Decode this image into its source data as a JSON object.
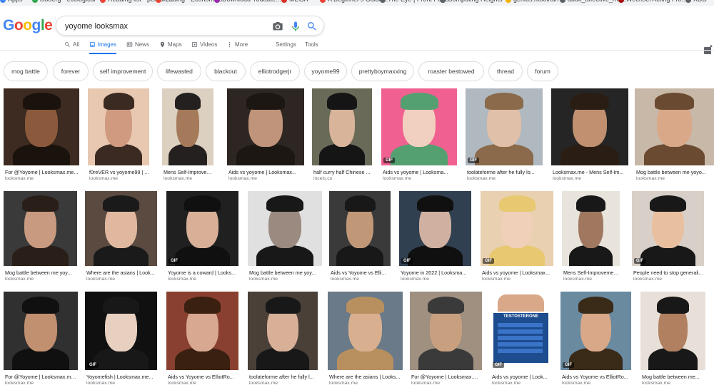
{
  "bookmarks": [
    {
      "label": "Apps",
      "color": "#4285f4"
    },
    {
      "label": "isoberg - ecological",
      "color": "#34a853"
    },
    {
      "label": "Reading list - person...",
      "color": "#ea4335"
    },
    {
      "label": "reading - Economics",
      "color": "#ea4335"
    },
    {
      "label": "Download Youtube...",
      "color": "#9c27b0"
    },
    {
      "label": "MEGA",
      "color": "#d93025"
    },
    {
      "label": "A Beginner's Guide...",
      "color": "#ea4335"
    },
    {
      "label": "The Eye | Front Page",
      "color": "#5f6368"
    },
    {
      "label": "Computing Heights",
      "color": "#5f6368"
    },
    {
      "label": "genius.ntoolrain",
      "color": "#f4b400"
    },
    {
      "label": "adult_affective_me...",
      "color": "#5f6368"
    },
    {
      "label": "Wechsel Acting Fro...",
      "color": "#a50e0e"
    },
    {
      "label": "XDD",
      "color": "#5f6368"
    }
  ],
  "search": {
    "query": "yoyome looksmax",
    "camera_icon": "camera-icon",
    "mic_icon": "mic-icon",
    "search_icon": "search-icon"
  },
  "logo": {
    "letters": [
      "G",
      "o",
      "o",
      "g",
      "l",
      "e"
    ],
    "colors": [
      "#4285f4",
      "#ea4335",
      "#fbbc05",
      "#4285f4",
      "#34a853",
      "#ea4335"
    ]
  },
  "tabs": [
    {
      "label": "All",
      "icon": "search-icon"
    },
    {
      "label": "Images",
      "icon": "image-icon",
      "active": true
    },
    {
      "label": "News",
      "icon": "news-icon"
    },
    {
      "label": "Maps",
      "icon": "map-pin-icon"
    },
    {
      "label": "Videos",
      "icon": "play-icon"
    },
    {
      "label": "More",
      "icon": "more-vert-icon"
    },
    {
      "label": "Settings"
    },
    {
      "label": "Tools"
    }
  ],
  "chips": [
    "mog battle",
    "forever",
    "self improvement",
    "lifewasted",
    "blackout",
    "elliotrodgerjr",
    "yoyome99",
    "prettyboymaxxing",
    "roaster bestowed",
    "thread",
    "forum"
  ],
  "rows": [
    [
      {
        "caption": "For @Yoyome | Looksmax.me...",
        "source": "looksmax.me",
        "gif": false
      },
      {
        "caption": "f0reVER vs yoyome99 | ...",
        "source": "looksmax.me",
        "gif": false
      },
      {
        "caption": "Mens Self-Improvemen...",
        "source": "looksmax.me",
        "gif": false
      },
      {
        "caption": "Aids vs yoyome | Looksmax...",
        "source": "looksmax.me",
        "gif": false
      },
      {
        "caption": "half curry half Chinese ...",
        "source": "incels.co",
        "gif": false
      },
      {
        "caption": "Aids vs yoyome | Looksma...",
        "source": "looksmax.me",
        "gif": true
      },
      {
        "caption": "toolateforme after he fully lo...",
        "source": "looksmax.me",
        "gif": true
      },
      {
        "caption": "Looksmax.me - Mens Self-Im...",
        "source": "looksmax.me",
        "gif": false
      },
      {
        "caption": "Mog battle between me yoyo...",
        "source": "looksmax.me",
        "gif": false
      }
    ],
    [
      {
        "caption": "Mog battle between me yoy...",
        "source": "looksmax.me",
        "gif": false
      },
      {
        "caption": "Where are the asians | Look...",
        "source": "looksmax.me",
        "gif": false
      },
      {
        "caption": "Yoyome is a coward | Looks...",
        "source": "looksmax.me",
        "gif": true
      },
      {
        "caption": "Mog battle between me yoy...",
        "source": "looksmax.me",
        "gif": false
      },
      {
        "caption": "Aids vs Yoyome vs Elli...",
        "source": "looksmax.me",
        "gif": false
      },
      {
        "caption": "Yoyome in 2022 | Looksma...",
        "source": "looksmax.me",
        "gif": true
      },
      {
        "caption": "Aids vs yoyome | Looksmax...",
        "source": "looksmax.me",
        "gif": true
      },
      {
        "caption": "Mens Self-Improvemen...",
        "source": "looksmax.me",
        "gif": false
      },
      {
        "caption": "People need to stop generali...",
        "source": "looksmax.me",
        "gif": true
      }
    ],
    [
      {
        "caption": "For @Yoyome | Looksmax.me...",
        "source": "looksmax.me",
        "gif": false
      },
      {
        "caption": "Yoyomefish | Looksmax.me...",
        "source": "looksmax.me",
        "gif": true
      },
      {
        "caption": "Aids vs Yoyome vs ElliotRo...",
        "source": "looksmax.me",
        "gif": false
      },
      {
        "caption": "toolateforme after he fully l...",
        "source": "looksmax.me",
        "gif": false
      },
      {
        "caption": "Where are the asians | Looks...",
        "source": "looksmax.me",
        "gif": false
      },
      {
        "caption": "For @Yoyome | Looksmax.me...",
        "source": "looksmax.me",
        "gif": false
      },
      {
        "caption": "Aids vs yoyome | Look...",
        "source": "looksmax.me",
        "gif": true
      },
      {
        "caption": "Aids vs Yoyome vs ElliotRo...",
        "source": "looksmax.me",
        "gif": true
      },
      {
        "caption": "Mog battle between me...",
        "source": "looksmax.me",
        "gif": false
      }
    ]
  ],
  "testosterone_label": "TESTOSTERONE",
  "gif_label": "GIF"
}
